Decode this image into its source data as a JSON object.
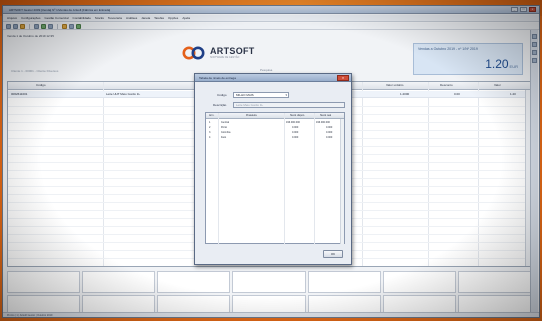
{
  "window": {
    "title": "ARTSOFT Gestor 2009 [Venda] Nº 1/Ventas de Artsoft [Fábrica em Entrada]",
    "buttons": {
      "minimize": "_",
      "maximize": "□",
      "close": "x"
    }
  },
  "menu": [
    {
      "label": "Arquivo"
    },
    {
      "label": "Configurações"
    },
    {
      "label": "Gestão Comercial"
    },
    {
      "label": "Contabilidade"
    },
    {
      "label": "Stocks"
    },
    {
      "label": "Tesouraria"
    },
    {
      "label": "Análises"
    },
    {
      "label": "Janela"
    },
    {
      "label": "Tarefas"
    },
    {
      "label": "Opções"
    },
    {
      "label": "Ajuda"
    }
  ],
  "header": {
    "info": "Venda 1 de Outubro de 2019 12:35",
    "sub": "Cliente 1 - 00001 - Cliente Diversos",
    "caption": "Pesquisa"
  },
  "logo": {
    "name": "ARTSOFT",
    "tagline": "SOFTWARE DE GESTÃO"
  },
  "total": {
    "label": "Vendas a Outubro 2019 - nº 1/Nº 2019",
    "value": "1.20",
    "unit": "EUR"
  },
  "grid": {
    "columns": [
      "Código",
      "Descrição",
      "Un.",
      "Valor unitário",
      "Desconto",
      "Valor"
    ],
    "rows": [
      {
        "code": "0062611001",
        "desc": "Leite UHT Meio Gordo 1L",
        "unit": "UN",
        "price": "1.2000",
        "discount": "0.00",
        "value": "1.20"
      }
    ]
  },
  "dialog": {
    "title": "Tabela de níveis de entrega",
    "code_label": "Código",
    "code_value": "MILHO MAIS",
    "desc_label": "Descrição",
    "desc_value": "Leite Meio Gordo 1L",
    "columns": [
      "Arm.",
      "Prateleira",
      "Stock dispon.",
      "Stock real"
    ],
    "rows": [
      {
        "arm": "1",
        "shelf": "Central",
        "avail": "196.000.000",
        "real": "196.000.000"
      },
      {
        "arm": "2",
        "shelf": "Porto",
        "avail": "0.000",
        "real": "0.000"
      },
      {
        "arm": "3",
        "shelf": "Coimbra",
        "avail": "0.000",
        "real": "0.000"
      },
      {
        "arm": "4",
        "shelf": "Faro",
        "avail": "0.000",
        "real": "0.000"
      }
    ],
    "ok_label": "OK"
  },
  "status": {
    "text": "Pronto | 1 | Artsoft Gestor | Outubro 2019"
  },
  "colors": {
    "background": "#e46a17",
    "accent": "#1f4c8f",
    "close": "#cf4d38"
  }
}
